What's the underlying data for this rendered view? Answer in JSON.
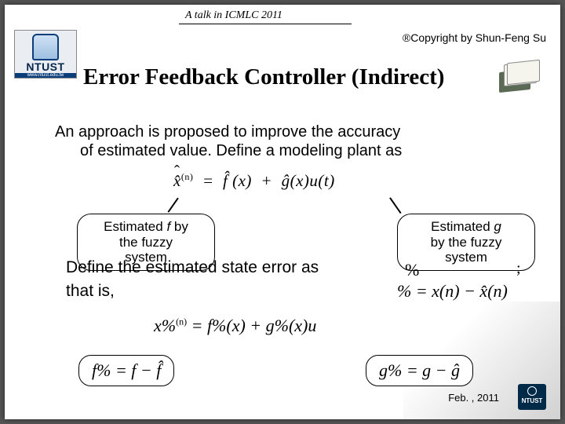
{
  "header": {
    "talk_line": "A talk in ICMLC 2011",
    "copyright": "®Copyright by Shun-Feng Su"
  },
  "logo": {
    "text": "NTUST",
    "url": "www.ntust.edu.tw"
  },
  "title": "Error Feedback Controller (Indirect)",
  "paragraph1_line1": "An approach is proposed to improve the accuracy",
  "paragraph1_line2": "of estimated value. Define a modeling plant as",
  "eq_main": {
    "lhs_var": "x̂",
    "lhs_sup": "(n)",
    "f_term": "f̂ (x)",
    "g_term": "ĝ(x)u(t)"
  },
  "callout_f_l1": "Estimated ",
  "callout_f_var": "f",
  "callout_f_l2": " by",
  "callout_f_l3": "the fuzzy",
  "callout_f_l4": "system",
  "callout_g_l1": "Estimated ",
  "callout_g_var": "g",
  "callout_g_l2": "by the fuzzy",
  "callout_g_l3": "system",
  "body2_a": "Define the estimated state error as",
  "body2_trail": ";",
  "body3": "that is,",
  "edef_inline": "%",
  "edef_eq": "% = x(n) − x̂(n)",
  "eq_second_lhs": "x%",
  "eq_second_sup": "(n)",
  "eq_second_rhs": " =  f%(x) + g%(x)u",
  "box_f": "f% = f − f̂",
  "box_g": "g% = g − ĝ",
  "footer_date": "Feb. , 2011",
  "mini_logo_text": "NTUST"
}
